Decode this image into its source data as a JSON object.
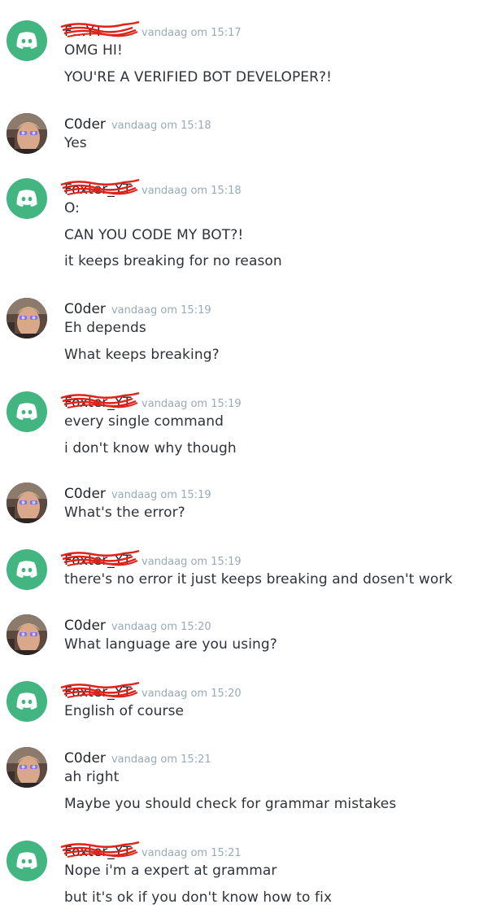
{
  "colors": {
    "discord_avatar_bg": "#43b581",
    "timestamp": "#99aab5",
    "text": "#2e3338",
    "redaction_scribble": "#e0221a"
  },
  "messages": [
    {
      "author": "F…YT",
      "author_redacted": true,
      "avatar": "discord-logo-icon",
      "timestamp": "vandaag om 15:17",
      "lines": [
        "OMG HI!",
        "YOU'RE A VERIFIED BOT DEVELOPER?!"
      ]
    },
    {
      "author": "C0der",
      "author_redacted": false,
      "avatar": "user-photo",
      "timestamp": "vandaag om 15:18",
      "lines": [
        "Yes"
      ]
    },
    {
      "author": "Foxter_YT",
      "author_redacted": true,
      "avatar": "discord-logo-icon",
      "timestamp": "vandaag om 15:18",
      "lines": [
        "O:",
        "CAN YOU CODE MY BOT?!",
        "it keeps breaking for no reason"
      ]
    },
    {
      "author": "C0der",
      "author_redacted": false,
      "avatar": "user-photo",
      "timestamp": "vandaag om 15:19",
      "lines": [
        "Eh depends",
        "What keeps breaking?"
      ]
    },
    {
      "author": "Foxter_YT",
      "author_redacted": true,
      "avatar": "discord-logo-icon",
      "timestamp": "vandaag om 15:19",
      "lines": [
        "every single command",
        "i don't know why though"
      ]
    },
    {
      "author": "C0der",
      "author_redacted": false,
      "avatar": "user-photo",
      "timestamp": "vandaag om 15:19",
      "lines": [
        "What's the error?"
      ]
    },
    {
      "author": "Foxter_YT",
      "author_redacted": true,
      "avatar": "discord-logo-icon",
      "timestamp": "vandaag om 15:19",
      "lines": [
        "there's no error it just keeps breaking and dosen't work"
      ]
    },
    {
      "author": "C0der",
      "author_redacted": false,
      "avatar": "user-photo",
      "timestamp": "vandaag om 15:20",
      "lines": [
        "What language are you using?"
      ]
    },
    {
      "author": "Foxter_YT",
      "author_redacted": true,
      "avatar": "discord-logo-icon",
      "timestamp": "vandaag om 15:20",
      "lines": [
        "English of course"
      ]
    },
    {
      "author": "C0der",
      "author_redacted": false,
      "avatar": "user-photo",
      "timestamp": "vandaag om 15:21",
      "lines": [
        "ah right",
        "Maybe you should check for grammar mistakes"
      ]
    },
    {
      "author": "Foxter_YT",
      "author_redacted": true,
      "avatar": "discord-logo-icon",
      "timestamp": "vandaag om 15:21",
      "lines": [
        "Nope i'm a expert at grammar",
        "but it's ok if you don't know how to fix"
      ]
    }
  ]
}
